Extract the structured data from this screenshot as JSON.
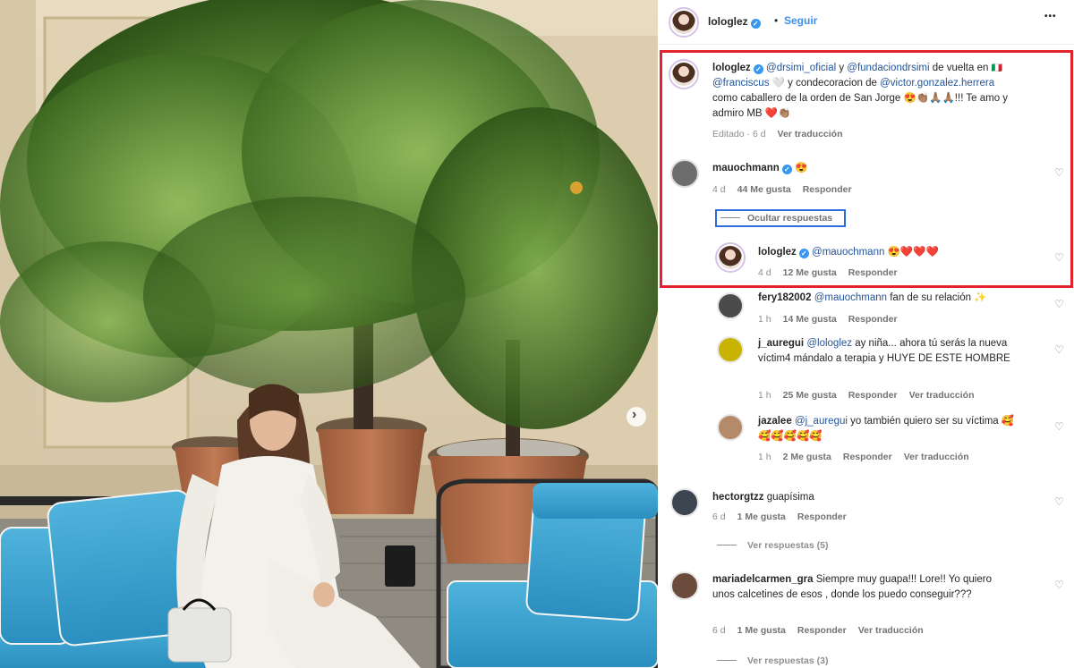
{
  "post": {
    "author": "lologlez",
    "follow_label": "Seguir",
    "more_label": "•••",
    "dot": "•"
  },
  "caption": {
    "username": "lologlez",
    "mention1": "@drsimi_oficial",
    "and1": " y ",
    "mention2": "@fundaciondrsimi",
    "text1": " de vuelta en ",
    "flag": "🇮🇹",
    "mention3": "@franciscus",
    "text2": " 🤍 y condecoracion de ",
    "mention4": "@victor.gonzalez.herrera",
    "text3": " como caballero de la orden de San Jorge 😍👏🏽🙏🏽🙏🏽!!! Te amo y admiro MB ❤️👏🏽",
    "edited": "Editado · 6 d",
    "translate": "Ver traducción"
  },
  "comments": [
    {
      "username": "mauochmann",
      "verified": true,
      "text": "😍",
      "time": "4 d",
      "likes": "44 Me gusta",
      "reply": "Responder",
      "toggle": "Ocultar respuestas",
      "avatar_color": "#6d6d6d",
      "replies": [
        {
          "username": "lologlez",
          "verified": true,
          "mention": "@mauochmann",
          "text": " 😍❤️❤️❤️",
          "time": "4 d",
          "likes": "12 Me gusta",
          "reply": "Responder"
        },
        {
          "username": "fery182002",
          "mention": "@mauochmann",
          "text": " fan de su relación ✨",
          "time": "1 h",
          "likes": "14 Me gusta",
          "reply": "Responder",
          "avatar_color": "#4b4b4b"
        },
        {
          "username": "j_auregui",
          "mention": "@lologlez",
          "text": " ay niña... ahora tú serás la nueva víctim4 mándalo a terapia y HUYE DE ESTE HOMBRE",
          "time": "1 h",
          "likes": "25 Me gusta",
          "reply": "Responder",
          "translate": "Ver traducción",
          "avatar_color": "#c8b400"
        },
        {
          "username": "jazalee",
          "mention": "@j_auregui",
          "text": " yo también quiero ser su víctima 🥰🥰🥰🥰🥰🥰",
          "time": "1 h",
          "likes": "2 Me gusta",
          "reply": "Responder",
          "translate": "Ver traducción",
          "avatar_color": "#b58a6a"
        }
      ]
    },
    {
      "username": "hectorgtzz",
      "text": "guapísima",
      "time": "6 d",
      "likes": "1 Me gusta",
      "reply": "Responder",
      "view_replies": "Ver respuestas (5)",
      "avatar_color": "#3c4650"
    },
    {
      "username": "mariadelcarmen_gra",
      "text": "Siempre muy guapa!!! Lore!! Yo quiero unos calcetines de esos , donde los puedo conseguir???",
      "time": "6 d",
      "likes": "1 Me gusta",
      "reply": "Responder",
      "translate": "Ver traducción",
      "view_replies": "Ver respuestas (3)",
      "avatar_color": "#6b4b3b"
    }
  ],
  "icons": {
    "heart": "♡",
    "verified": "✓",
    "carousel_next": "›"
  },
  "colors": {
    "link": "#3d8ff0",
    "mention": "#24559a",
    "highlight": "#e0242e",
    "verified": "#3897f0"
  }
}
